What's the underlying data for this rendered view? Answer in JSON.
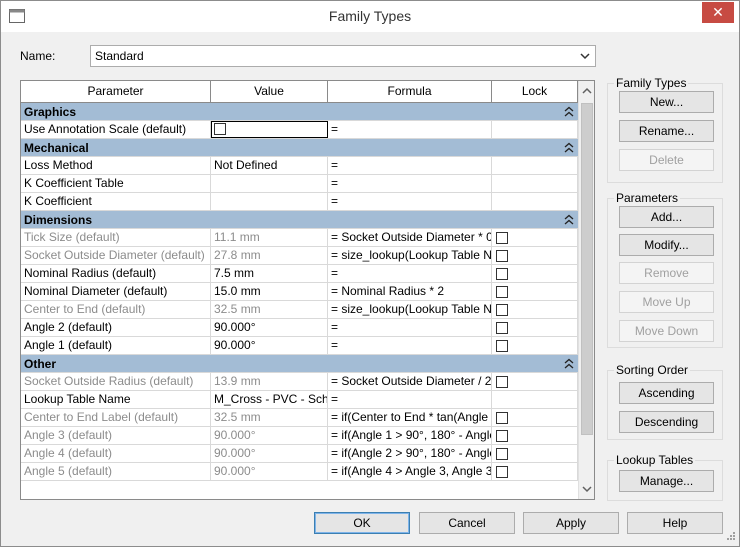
{
  "window": {
    "title": "Family Types",
    "close_glyph": "✕"
  },
  "name_field": {
    "label": "Name:",
    "value": "Standard"
  },
  "grid": {
    "headers": [
      "Parameter",
      "Value",
      "Formula",
      "Lock"
    ],
    "groups": [
      {
        "title": "Graphics",
        "rows": [
          {
            "param": "Use Annotation Scale (default)",
            "value": "",
            "formula": "=",
            "lock": false,
            "value_checkbox": true,
            "dim": false
          }
        ]
      },
      {
        "title": "Mechanical",
        "rows": [
          {
            "param": "Loss Method",
            "value": "Not Defined",
            "formula": "=",
            "lock": false,
            "dim": false
          },
          {
            "param": "K Coefficient Table",
            "value": "",
            "formula": "=",
            "lock": false,
            "dim": false
          },
          {
            "param": "K Coefficient",
            "value": "",
            "formula": "=",
            "lock": false,
            "dim": false
          }
        ]
      },
      {
        "title": "Dimensions",
        "rows": [
          {
            "param": "Tick Size (default)",
            "value": "11.1 mm",
            "formula": "= Socket Outside Diameter * 0.",
            "lock": true,
            "dim": true
          },
          {
            "param": "Socket Outside Diameter (default)",
            "value": "27.8 mm",
            "formula": "= size_lookup(Lookup Table N",
            "lock": true,
            "dim": true
          },
          {
            "param": "Nominal Radius (default)",
            "value": "7.5 mm",
            "formula": "=",
            "lock": true,
            "dim": false
          },
          {
            "param": "Nominal Diameter (default)",
            "value": "15.0 mm",
            "formula": "= Nominal Radius * 2",
            "lock": true,
            "dim": false
          },
          {
            "param": "Center to End (default)",
            "value": "32.5 mm",
            "formula": "= size_lookup(Lookup Table N",
            "lock": true,
            "dim": true
          },
          {
            "param": "Angle 2 (default)",
            "value": "90.000°",
            "formula": "=",
            "lock": true,
            "dim": false
          },
          {
            "param": "Angle 1 (default)",
            "value": "90.000°",
            "formula": "=",
            "lock": true,
            "dim": false
          }
        ]
      },
      {
        "title": "Other",
        "rows": [
          {
            "param": "Socket Outside Radius (default)",
            "value": "13.9 mm",
            "formula": "= Socket Outside Diameter / 2",
            "lock": true,
            "dim": true
          },
          {
            "param": "Lookup Table Name",
            "value": "M_Cross - PVC - Sch",
            "formula": "=",
            "lock": false,
            "dim": false
          },
          {
            "param": "Center to End Label (default)",
            "value": "32.5 mm",
            "formula": "= if(Center to End * tan(Angle",
            "lock": true,
            "dim": true
          },
          {
            "param": "Angle 3 (default)",
            "value": "90.000°",
            "formula": "= if(Angle 1 > 90°, 180° - Angle",
            "lock": true,
            "dim": true
          },
          {
            "param": "Angle 4 (default)",
            "value": "90.000°",
            "formula": "= if(Angle 2 > 90°, 180° - Angle",
            "lock": true,
            "dim": true
          },
          {
            "param": "Angle 5 (default)",
            "value": "90.000°",
            "formula": "= if(Angle 4 > Angle 3, Angle 3",
            "lock": true,
            "dim": true
          }
        ]
      }
    ]
  },
  "family_types": {
    "title": "Family Types",
    "new": "New...",
    "rename": "Rename...",
    "delete": "Delete"
  },
  "parameters": {
    "title": "Parameters",
    "add": "Add...",
    "modify": "Modify...",
    "remove": "Remove",
    "move_up": "Move Up",
    "move_down": "Move Down"
  },
  "sorting": {
    "title": "Sorting Order",
    "ascending": "Ascending",
    "descending": "Descending"
  },
  "lookup": {
    "title": "Lookup Tables",
    "manage": "Manage..."
  },
  "bottom": {
    "ok": "OK",
    "cancel": "Cancel",
    "apply": "Apply",
    "help": "Help"
  },
  "icons": [
    "app-icon",
    "close-icon",
    "chevron-down-icon",
    "collapse-icon",
    "checkbox-icon",
    "scroll-arrow-icon",
    "size-grip-icon"
  ]
}
